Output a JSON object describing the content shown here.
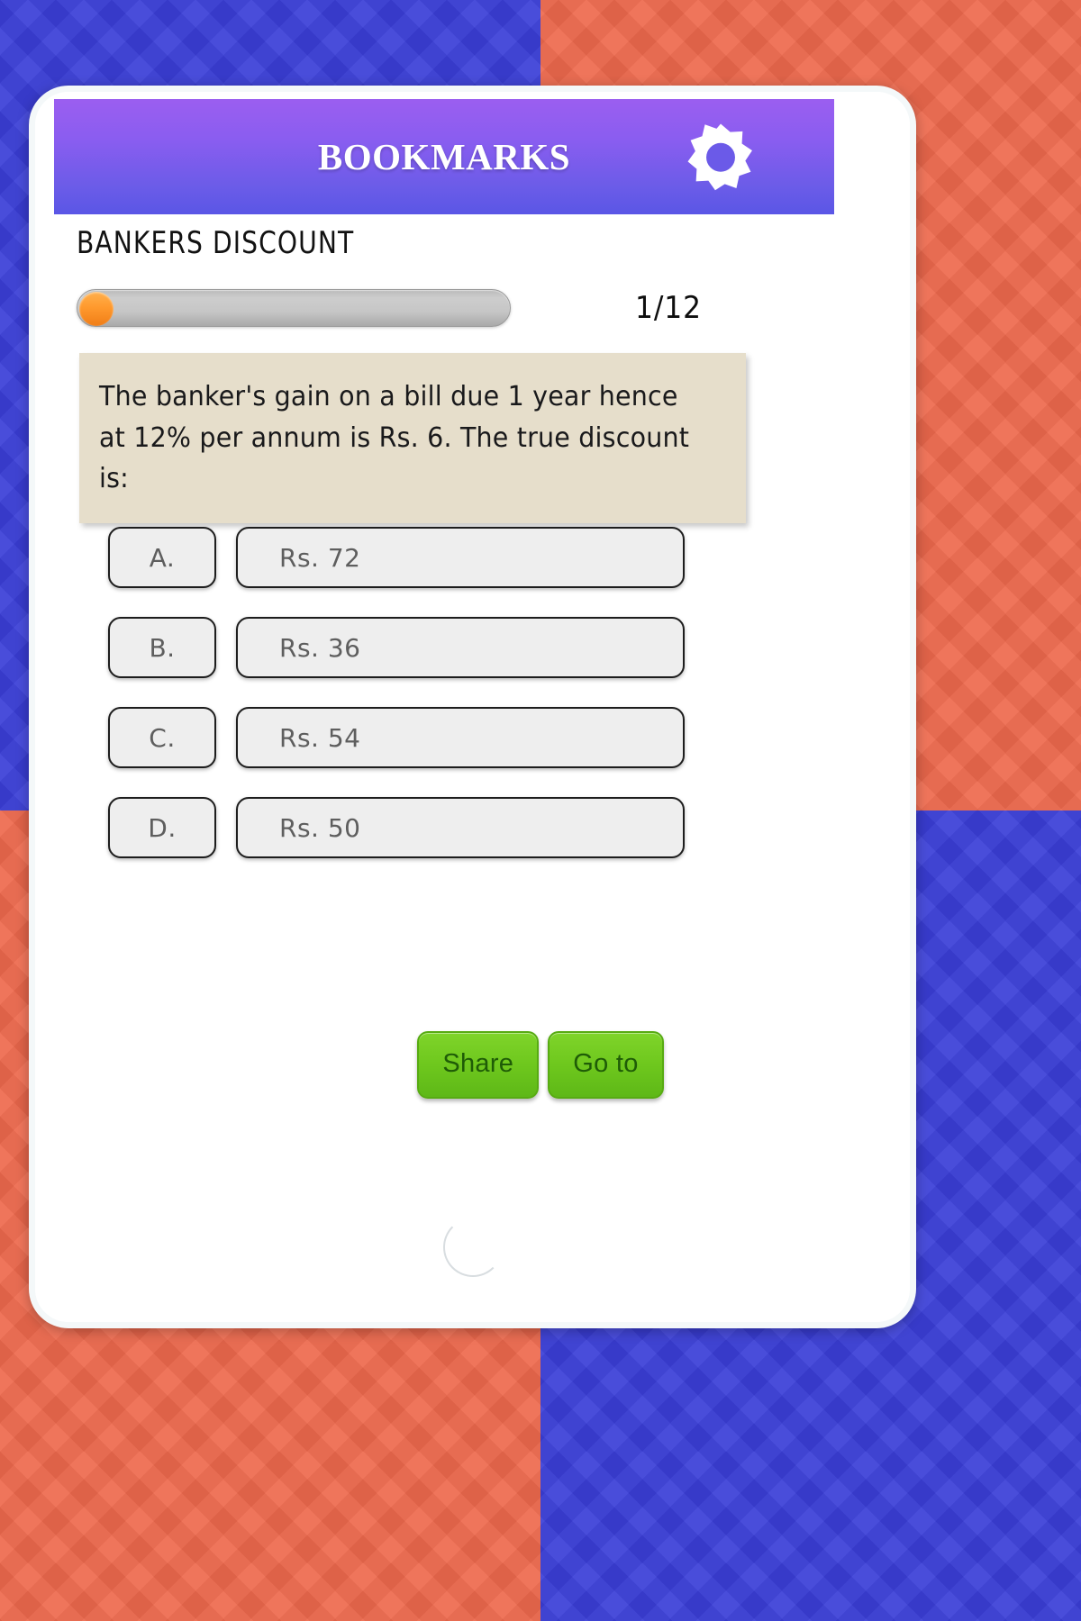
{
  "background": {
    "color_blue": "#3b3fd8",
    "color_orange": "#ee6a4e"
  },
  "header": {
    "title": "BOOKMARKS",
    "gradient_top": "#9b5ef0",
    "gradient_bottom": "#5a56e6",
    "settings_icon": "gear-icon"
  },
  "quiz": {
    "category": "BANKERS DISCOUNT",
    "counter": "1/12",
    "progress_percent": 8,
    "progress_fill_color": "#ff9a2e",
    "question": "The banker's gain on a bill due 1 year hence at 12% per annum is Rs. 6. The true discount is:",
    "options": [
      {
        "letter": "A.",
        "value": "Rs. 72"
      },
      {
        "letter": "B.",
        "value": "Rs. 36"
      },
      {
        "letter": "C.",
        "value": "Rs. 54"
      },
      {
        "letter": "D.",
        "value": "Rs. 50"
      }
    ]
  },
  "actions": {
    "share_label": "Share",
    "goto_label": "Go to",
    "button_color": "#6fc81e"
  }
}
